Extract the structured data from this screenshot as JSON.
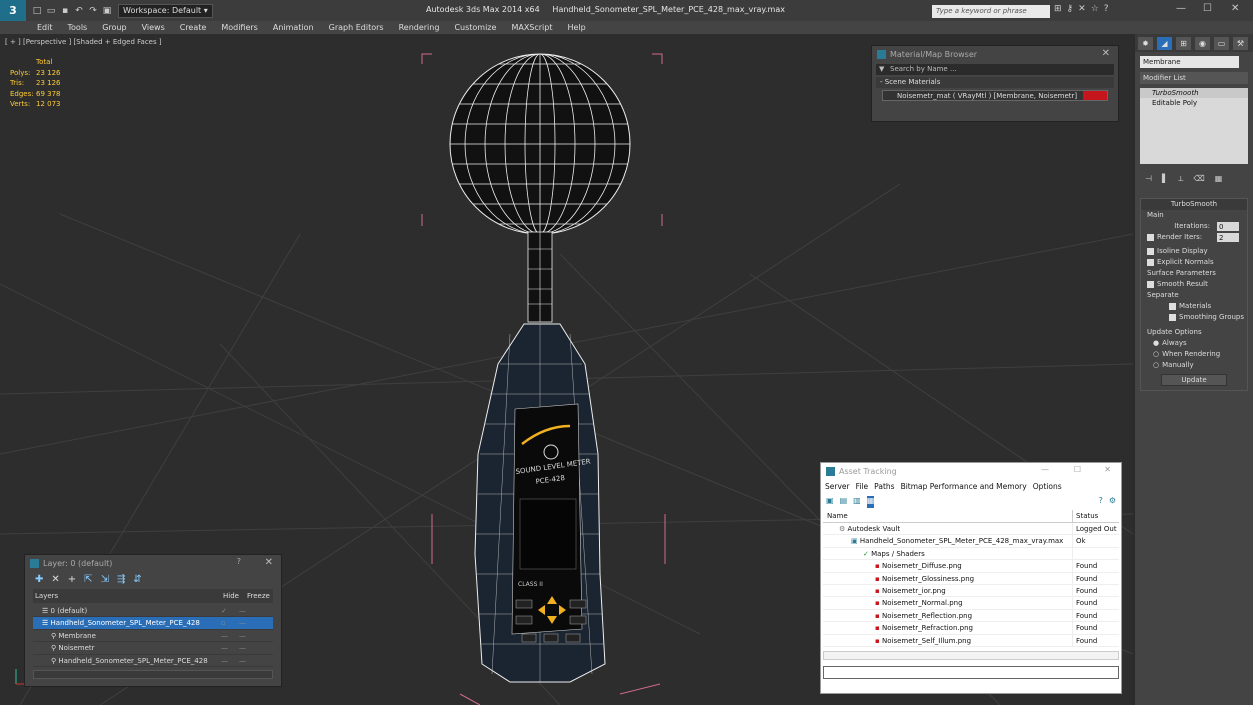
{
  "app": {
    "title": "Autodesk 3ds Max 2014 x64",
    "filename": "Handheld_Sonometer_SPL_Meter_PCE_428_max_vray.max",
    "workspace": "Workspace: Default",
    "search_placeholder": "Type a keyword or phrase"
  },
  "menu": [
    "Edit",
    "Tools",
    "Group",
    "Views",
    "Create",
    "Modifiers",
    "Animation",
    "Graph Editors",
    "Rendering",
    "Customize",
    "MAXScript",
    "Help"
  ],
  "viewport": {
    "label": "[ + ] [Perspective ] [Shaded + Edged Faces ]",
    "stats": {
      "header": "Total",
      "rows": [
        {
          "k": "Polys:",
          "v": "23 126"
        },
        {
          "k": "Tris:",
          "v": "23 126"
        },
        {
          "k": "Edges:",
          "v": "69 378"
        },
        {
          "k": "Verts:",
          "v": "12 073"
        }
      ]
    }
  },
  "model_labels": {
    "brand": "SOUND LEVEL METER",
    "model": "PCE-428",
    "class": "CLASS II"
  },
  "material_browser": {
    "title": "Material/Map Browser",
    "search": "Search by Name ...",
    "section": "- Scene Materials",
    "material": "Noisemetr_mat ( VRayMtl ) [Membrane, Noisemetr]"
  },
  "command_panel": {
    "object_name": "Membrane",
    "modifier_list": "Modifier List",
    "stack": [
      "TurboSmooth",
      "Editable Poly"
    ],
    "turbosmooth": {
      "title": "TurboSmooth",
      "main": "Main",
      "iterations_label": "Iterations:",
      "iterations": "0",
      "render_iters_label": "Render Iters:",
      "render_iters": "2",
      "isoline": "Isoline Display",
      "explicit": "Explicit Normals",
      "surface": "Surface Parameters",
      "smooth_result": "Smooth Result",
      "separate": "Separate",
      "materials": "Materials",
      "smoothing_groups": "Smoothing Groups",
      "update_options": "Update Options",
      "always": "Always",
      "when_rendering": "When Rendering",
      "manually": "Manually",
      "update": "Update"
    }
  },
  "layer_panel": {
    "title": "Layer: 0 (default)",
    "cols": [
      "Layers",
      "Hide",
      "Freeze"
    ],
    "rows": [
      {
        "name": "0 (default)",
        "indent": 1
      },
      {
        "name": "Handheld_Sonometer_SPL_Meter_PCE_428",
        "indent": 1,
        "selected": true
      },
      {
        "name": "Membrane",
        "indent": 2
      },
      {
        "name": "Noisemetr",
        "indent": 2
      },
      {
        "name": "Handheld_Sonometer_SPL_Meter_PCE_428",
        "indent": 2
      }
    ]
  },
  "asset_tracking": {
    "title": "Asset Tracking",
    "menu": [
      "Server",
      "File",
      "Paths",
      "Bitmap Performance and Memory",
      "Options"
    ],
    "cols": [
      "Name",
      "Status"
    ],
    "rows": [
      {
        "name": "Autodesk Vault",
        "status": "Logged Out",
        "indent": 1
      },
      {
        "name": "Handheld_Sonometer_SPL_Meter_PCE_428_max_vray.max",
        "status": "Ok",
        "indent": 2
      },
      {
        "name": "Maps / Shaders",
        "status": "",
        "indent": 3
      },
      {
        "name": "Noisemetr_Diffuse.png",
        "status": "Found",
        "indent": 4
      },
      {
        "name": "Noisemetr_Glossiness.png",
        "status": "Found",
        "indent": 4
      },
      {
        "name": "Noisemetr_ior.png",
        "status": "Found",
        "indent": 4
      },
      {
        "name": "Noisemetr_Normal.png",
        "status": "Found",
        "indent": 4
      },
      {
        "name": "Noisemetr_Reflection.png",
        "status": "Found",
        "indent": 4
      },
      {
        "name": "Noisemetr_Refraction.png",
        "status": "Found",
        "indent": 4
      },
      {
        "name": "Noisemetr_Self_Illum.png",
        "status": "Found",
        "indent": 4
      }
    ]
  }
}
